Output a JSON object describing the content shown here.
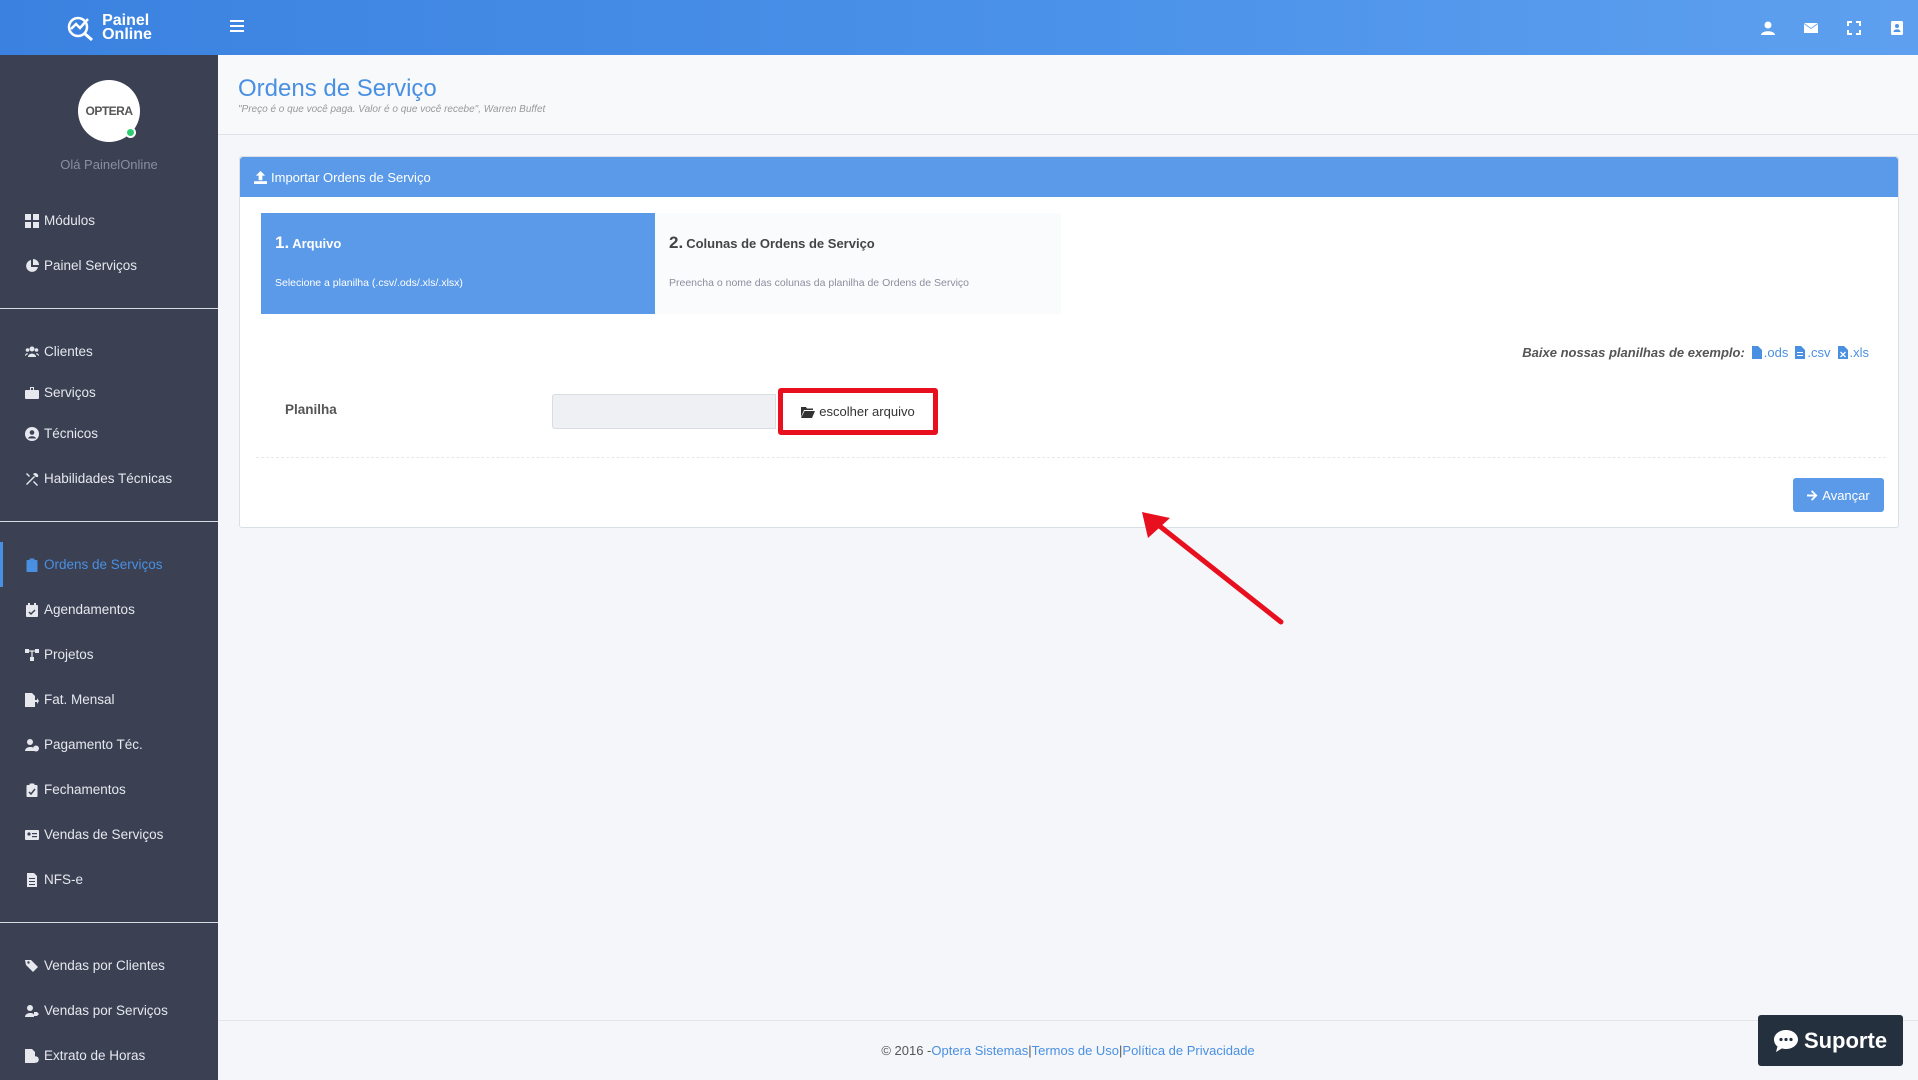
{
  "brand": {
    "line1": "Painel",
    "line2": "Online"
  },
  "sidebar": {
    "avatar_text": "OPTERA",
    "greeting": "Olá PainelOnline",
    "groups": [
      [
        {
          "label": "Módulos",
          "icon": "grid-icon"
        },
        {
          "label": "Painel Serviços",
          "icon": "pie-chart-icon"
        }
      ],
      [
        {
          "label": "Clientes",
          "icon": "users-icon"
        },
        {
          "label": "Serviços",
          "icon": "briefcase-icon"
        },
        {
          "label": "Técnicos",
          "icon": "user-circle-icon"
        },
        {
          "label": "Habilidades Técnicas",
          "icon": "tools-icon"
        }
      ],
      [
        {
          "label": "Ordens de Serviços",
          "icon": "clipboard-icon",
          "active": true
        },
        {
          "label": "Agendamentos",
          "icon": "calendar-check-icon"
        },
        {
          "label": "Projetos",
          "icon": "sitemap-icon"
        },
        {
          "label": "Fat. Mensal",
          "icon": "file-export-icon"
        },
        {
          "label": "Pagamento Téc.",
          "icon": "user-clock-icon"
        },
        {
          "label": "Fechamentos",
          "icon": "clipboard-check-icon"
        },
        {
          "label": "Vendas de Serviços",
          "icon": "id-card-icon"
        },
        {
          "label": "NFS-e",
          "icon": "file-text-icon"
        }
      ],
      [
        {
          "label": "Vendas por Clientes",
          "icon": "tags-icon"
        },
        {
          "label": "Vendas por Serviços",
          "icon": "user-tag-icon"
        },
        {
          "label": "Extrato de Horas",
          "icon": "file-clock-icon"
        }
      ]
    ]
  },
  "header": {
    "title": "Ordens de Serviço",
    "quote": "\"Preço é o que você paga. Valor é o que você recebe\", Warren Buffet"
  },
  "panel": {
    "heading": "Importar Ordens de Serviço",
    "steps": [
      {
        "num": "1.",
        "title": "Arquivo",
        "desc": "Selecione a planilha (.csv/.ods/.xls/.xlsx)"
      },
      {
        "num": "2.",
        "title": "Colunas de Ordens de Serviço",
        "desc": "Preencha o nome das colunas da planilha de Ordens de Serviço"
      }
    ],
    "downloads_label": "Baixe nossas planilhas de exemplo:",
    "downloads": [
      ".ods",
      ".csv",
      ".xls"
    ],
    "field_label": "Planilha",
    "choose_label": "escolher arquivo",
    "next_label": "Avançar"
  },
  "footer": {
    "copyright": "© 2016 - ",
    "company": "Optera Sistemas",
    "sep1": " | ",
    "terms": "Termos de Uso",
    "sep2": " | ",
    "privacy": "Política de Privacidade"
  },
  "support_label": "Suporte",
  "colors": {
    "accent": "#4a90e2",
    "highlight": "#e8101e",
    "sidebar": "#3b4053"
  }
}
